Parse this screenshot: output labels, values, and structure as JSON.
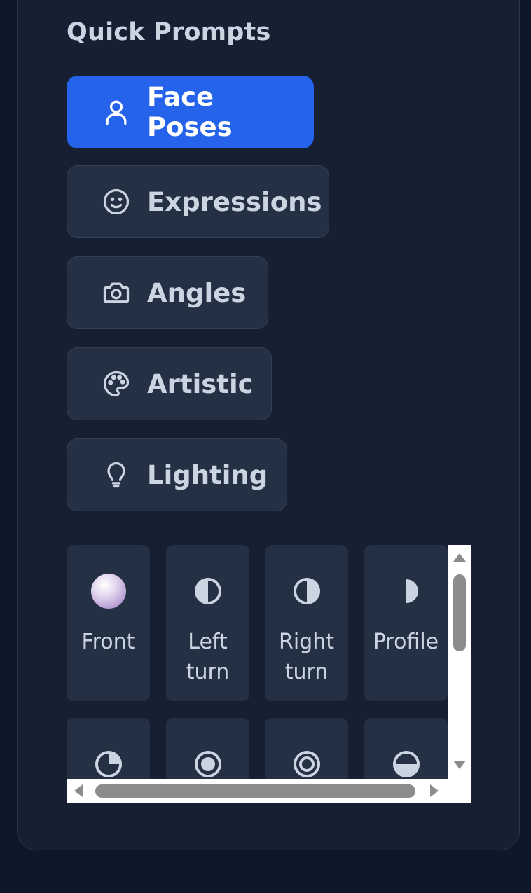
{
  "quick_prompts": {
    "title": "Quick Prompts",
    "categories": [
      {
        "label": "Face Poses",
        "icon": "user-icon",
        "active": true
      },
      {
        "label": "Expressions",
        "icon": "smile-icon",
        "active": false
      },
      {
        "label": "Angles",
        "icon": "camera-icon",
        "active": false
      },
      {
        "label": "Artistic",
        "icon": "palette-icon",
        "active": false
      },
      {
        "label": "Lighting",
        "icon": "lightbulb-icon",
        "active": false
      }
    ],
    "poses": [
      {
        "label": "Front",
        "icon": "sphere-icon"
      },
      {
        "label": "Left\nturn",
        "icon": "half-circle-left-icon"
      },
      {
        "label": "Right\nturn",
        "icon": "half-circle-right-icon"
      },
      {
        "label": "Profile",
        "icon": "half-moon-icon"
      },
      {
        "label": "",
        "icon": "quarter-circle-icon"
      },
      {
        "label": "",
        "icon": "circled-dot-icon"
      },
      {
        "label": "",
        "icon": "bullseye-icon"
      },
      {
        "label": "",
        "icon": "bottom-half-circle-icon"
      }
    ]
  },
  "colors": {
    "accent": "#2563eb",
    "panel": "#172033",
    "button": "#243044",
    "text": "#cbd5e1"
  }
}
